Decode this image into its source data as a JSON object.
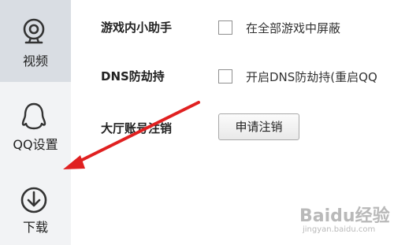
{
  "sidebar": {
    "items": [
      {
        "label": "视频",
        "icon": "webcam-icon",
        "active": true
      },
      {
        "label": "QQ设置",
        "icon": "penguin-icon",
        "active": false
      },
      {
        "label": "下载",
        "icon": "download-icon",
        "active": false
      }
    ]
  },
  "settings": {
    "game_helper": {
      "label": "游戏内小助手",
      "option": "在全部游戏中屏蔽",
      "checked": false
    },
    "dns": {
      "label": "DNS防劫持",
      "option": "开启DNS防劫持(重启QQ",
      "checked": false
    },
    "account": {
      "label": "大厅账号注销",
      "button": "申请注销"
    }
  },
  "annotation": {
    "color": "#e02020"
  },
  "watermark": {
    "text": "Baidu经验",
    "url": "jingyan.baidu.com"
  }
}
